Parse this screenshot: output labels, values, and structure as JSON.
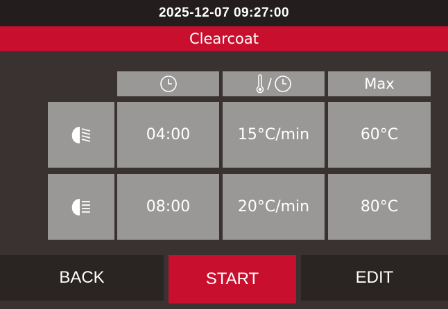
{
  "status_bar": {
    "datetime": "2025-12-07 09:27:00"
  },
  "program": {
    "name": "Clearcoat"
  },
  "table": {
    "headers": [
      {
        "icon": "clock-icon"
      },
      {
        "icon": "thermometer-per-clock-icon",
        "separator": "/"
      },
      {
        "label": "Max"
      }
    ],
    "rows": [
      {
        "icon": "heat-lamp-low-icon",
        "time": "04:00",
        "rate": "15°C/min",
        "max": "60°C"
      },
      {
        "icon": "heat-lamp-high-icon",
        "time": "08:00",
        "rate": "20°C/min",
        "max": "80°C"
      }
    ]
  },
  "buttons": {
    "back": "BACK",
    "start": "START",
    "edit": "EDIT"
  },
  "colors": {
    "accent": "#c8102e",
    "cell": "#999897",
    "background": "#3a3230"
  }
}
